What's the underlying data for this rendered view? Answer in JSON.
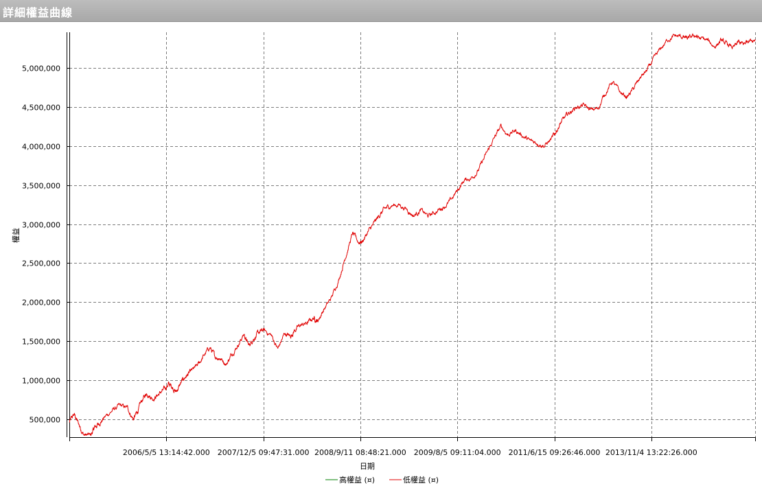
{
  "window": {
    "title": "詳細權益曲線"
  },
  "colors": {
    "series_high": "#008000",
    "series_low": "#e00000",
    "grid": "#7a7a7a",
    "axis": "#000000",
    "title_bar": "#b4b4b4"
  },
  "chart_data": {
    "type": "line",
    "title": "",
    "xlabel": "日期",
    "ylabel": "權益",
    "ylim": [
      270000,
      5460000
    ],
    "yticks": [
      500000,
      1000000,
      1500000,
      2000000,
      2500000,
      3000000,
      3500000,
      4000000,
      4500000,
      5000000
    ],
    "ytick_labels": [
      "500,000",
      "1,000,000",
      "1,500,000",
      "2,000,000",
      "2,500,000",
      "3,000,000",
      "3,500,000",
      "4,000,000",
      "4,500,000",
      "5,000,000"
    ],
    "xlim": [
      0,
      7.07
    ],
    "xticks": [
      1,
      2,
      3,
      4,
      5,
      6
    ],
    "xtick_labels": [
      "2006/5/5 13:14:42.000",
      "2007/12/5 09:47:31.000",
      "2008/9/11 08:48:21.000",
      "2009/8/5 09:11:04.000",
      "2011/6/15 09:26:46.000",
      "2013/11/4 13:22:26.000"
    ],
    "grid": true,
    "legend_position": "bottom-center",
    "legend": [
      {
        "name": "高權益 (¤)",
        "color": "#008000"
      },
      {
        "name": "低權益 (¤)",
        "color": "#e00000"
      }
    ],
    "series": [
      {
        "name": "低權益 (¤)",
        "color": "#e00000",
        "x": [
          0,
          0.05,
          0.1,
          0.15,
          0.22,
          0.26,
          0.3,
          0.36,
          0.45,
          0.52,
          0.6,
          0.66,
          0.7,
          0.75,
          0.8,
          0.86,
          0.92,
          0.98,
          1.02,
          1.06,
          1.1,
          1.15,
          1.2,
          1.25,
          1.32,
          1.38,
          1.45,
          1.5,
          1.55,
          1.62,
          1.68,
          1.75,
          1.8,
          1.85,
          1.9,
          1.95,
          2.0,
          2.08,
          2.15,
          2.22,
          2.28,
          2.32,
          2.38,
          2.45,
          2.52,
          2.56,
          2.62,
          2.7,
          2.78,
          2.85,
          2.92,
          2.98,
          3.02,
          3.08,
          3.15,
          3.2,
          3.25,
          3.32,
          3.4,
          3.48,
          3.55,
          3.62,
          3.7,
          3.78,
          3.85,
          3.92,
          4.0,
          4.07,
          4.15,
          4.22,
          4.3,
          4.38,
          4.45,
          4.52,
          4.6,
          4.68,
          4.75,
          4.82,
          4.9,
          4.98,
          5.02,
          5.08,
          5.15,
          5.22,
          5.3,
          5.38,
          5.45,
          5.52,
          5.6,
          5.68,
          5.75,
          5.82,
          5.88,
          5.95,
          6.02,
          6.1,
          6.18,
          6.25,
          6.32,
          6.38,
          6.45,
          6.5,
          6.58,
          6.65,
          6.72,
          6.78,
          6.85,
          6.9,
          6.95,
          7.0,
          7.07
        ],
        "values": [
          460000,
          560000,
          430000,
          300000,
          290000,
          390000,
          440000,
          520000,
          620000,
          670000,
          640000,
          500000,
          590000,
          740000,
          840000,
          770000,
          820000,
          880000,
          950000,
          920000,
          850000,
          960000,
          1050000,
          1100000,
          1180000,
          1300000,
          1420000,
          1300000,
          1290000,
          1210000,
          1350000,
          1480000,
          1590000,
          1440000,
          1540000,
          1600000,
          1640000,
          1580000,
          1400000,
          1600000,
          1560000,
          1640000,
          1700000,
          1730000,
          1800000,
          1760000,
          1900000,
          2050000,
          2300000,
          2600000,
          2880000,
          2770000,
          2780000,
          2900000,
          3020000,
          3120000,
          3190000,
          3240000,
          3250000,
          3190000,
          3110000,
          3180000,
          3100000,
          3160000,
          3220000,
          3280000,
          3430000,
          3560000,
          3600000,
          3700000,
          3900000,
          4100000,
          4250000,
          4150000,
          4200000,
          4130000,
          4060000,
          4050000,
          4010000,
          4100000,
          4200000,
          4320000,
          4420000,
          4500000,
          4520000,
          4460000,
          4480000,
          4670000,
          4830000,
          4680000,
          4630000,
          4740000,
          4870000,
          4960000,
          5100000,
          5250000,
          5380000,
          5410000,
          5400000,
          5370000,
          5420000,
          5380000,
          5350000,
          5280000,
          5350000,
          5300000,
          5260000,
          5330000,
          5300000,
          5370000,
          5370000
        ]
      }
    ]
  }
}
